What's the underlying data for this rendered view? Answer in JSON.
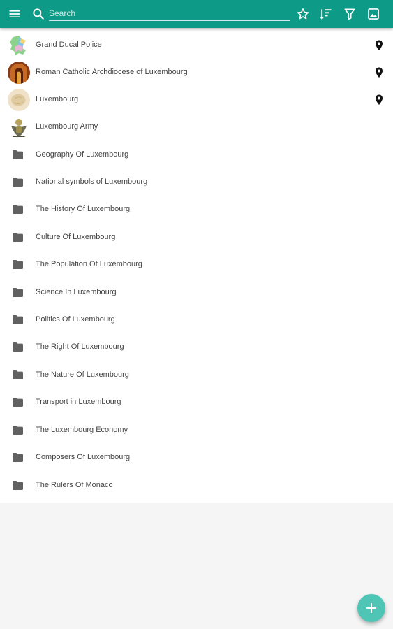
{
  "colors": {
    "appbar": "#0d9a86",
    "fab": "#4fc5b5",
    "background": "#f5f5f5",
    "list": "#ffffff"
  },
  "toolbar": {
    "menu_icon": "menu-icon",
    "search_icon": "search-icon",
    "search_placeholder": "Search",
    "actions": [
      "star-icon",
      "sort-icon",
      "filter-icon",
      "image-icon"
    ]
  },
  "items": [
    {
      "label": "Grand Ducal Police",
      "icon": "police-map-thumbnail",
      "pin": true
    },
    {
      "label": "Roman Catholic Archdiocese of Luxembourg",
      "icon": "cathedral-thumbnail",
      "pin": true
    },
    {
      "label": "Luxembourg",
      "icon": "luxembourg-thumbnail",
      "pin": true
    },
    {
      "label": "Luxembourg Army",
      "icon": "army-emblem-thumbnail",
      "pin": false
    },
    {
      "label": "Geography Of Luxembourg",
      "icon": "folder-icon",
      "pin": false
    },
    {
      "label": "National symbols of Luxembourg",
      "icon": "folder-icon",
      "pin": false
    },
    {
      "label": "The History Of Luxembourg",
      "icon": "folder-icon",
      "pin": false
    },
    {
      "label": "Culture Of Luxembourg",
      "icon": "folder-icon",
      "pin": false
    },
    {
      "label": "The Population Of Luxembourg",
      "icon": "folder-icon",
      "pin": false
    },
    {
      "label": "Science In Luxembourg",
      "icon": "folder-icon",
      "pin": false
    },
    {
      "label": "Politics Of Luxembourg",
      "icon": "folder-icon",
      "pin": false
    },
    {
      "label": "The Right Of Luxembourg",
      "icon": "folder-icon",
      "pin": false
    },
    {
      "label": "The Nature Of Luxembourg",
      "icon": "folder-icon",
      "pin": false
    },
    {
      "label": "Transport in Luxembourg",
      "icon": "folder-icon",
      "pin": false
    },
    {
      "label": "The Luxembourg Economy",
      "icon": "folder-icon",
      "pin": false
    },
    {
      "label": "Composers Of Luxembourg",
      "icon": "folder-icon",
      "pin": false
    },
    {
      "label": "The Rulers Of Monaco",
      "icon": "folder-icon",
      "pin": false
    }
  ],
  "fab": {
    "icon": "plus-icon"
  }
}
